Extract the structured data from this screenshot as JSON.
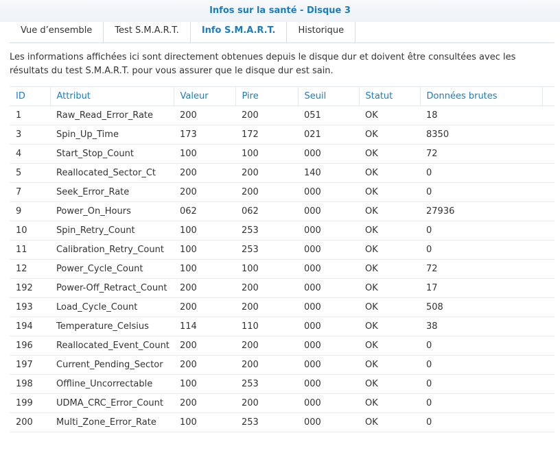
{
  "window": {
    "title": "Infos sur la santé - Disque 3"
  },
  "tabs": [
    {
      "label": "Vue d’ensemble",
      "active": false
    },
    {
      "label": "Test S.M.A.R.T.",
      "active": false
    },
    {
      "label": "Info S.M.A.R.T.",
      "active": true
    },
    {
      "label": "Historique",
      "active": false
    }
  ],
  "description": "Les informations affichées ici sont directement obtenues depuis le disque dur et doivent être consultées avec les résultats du test S.M.A.R.T. pour vous assurer que le disque dur est sain.",
  "table": {
    "columns": [
      "ID",
      "Attribut",
      "Valeur",
      "Pire",
      "Seuil",
      "Statut",
      "Données brutes"
    ],
    "rows": [
      [
        "1",
        "Raw_Read_Error_Rate",
        "200",
        "200",
        "051",
        "OK",
        "18"
      ],
      [
        "3",
        "Spin_Up_Time",
        "173",
        "172",
        "021",
        "OK",
        "8350"
      ],
      [
        "4",
        "Start_Stop_Count",
        "100",
        "100",
        "000",
        "OK",
        "72"
      ],
      [
        "5",
        "Reallocated_Sector_Ct",
        "200",
        "200",
        "140",
        "OK",
        "0"
      ],
      [
        "7",
        "Seek_Error_Rate",
        "200",
        "200",
        "000",
        "OK",
        "0"
      ],
      [
        "9",
        "Power_On_Hours",
        "062",
        "062",
        "000",
        "OK",
        "27936"
      ],
      [
        "10",
        "Spin_Retry_Count",
        "100",
        "253",
        "000",
        "OK",
        "0"
      ],
      [
        "11",
        "Calibration_Retry_Count",
        "100",
        "253",
        "000",
        "OK",
        "0"
      ],
      [
        "12",
        "Power_Cycle_Count",
        "100",
        "100",
        "000",
        "OK",
        "72"
      ],
      [
        "192",
        "Power-Off_Retract_Count",
        "200",
        "200",
        "000",
        "OK",
        "17"
      ],
      [
        "193",
        "Load_Cycle_Count",
        "200",
        "200",
        "000",
        "OK",
        "508"
      ],
      [
        "194",
        "Temperature_Celsius",
        "114",
        "110",
        "000",
        "OK",
        "38"
      ],
      [
        "196",
        "Reallocated_Event_Count",
        "200",
        "200",
        "000",
        "OK",
        "0"
      ],
      [
        "197",
        "Current_Pending_Sector",
        "200",
        "200",
        "000",
        "OK",
        "0"
      ],
      [
        "198",
        "Offline_Uncorrectable",
        "100",
        "253",
        "000",
        "OK",
        "0"
      ],
      [
        "199",
        "UDMA_CRC_Error_Count",
        "200",
        "200",
        "000",
        "OK",
        "0"
      ],
      [
        "200",
        "Multi_Zone_Error_Rate",
        "100",
        "253",
        "000",
        "OK",
        "0"
      ]
    ]
  },
  "colors": {
    "accent": "#1a7dc0",
    "text": "#333333",
    "border": "#d6dde4"
  }
}
